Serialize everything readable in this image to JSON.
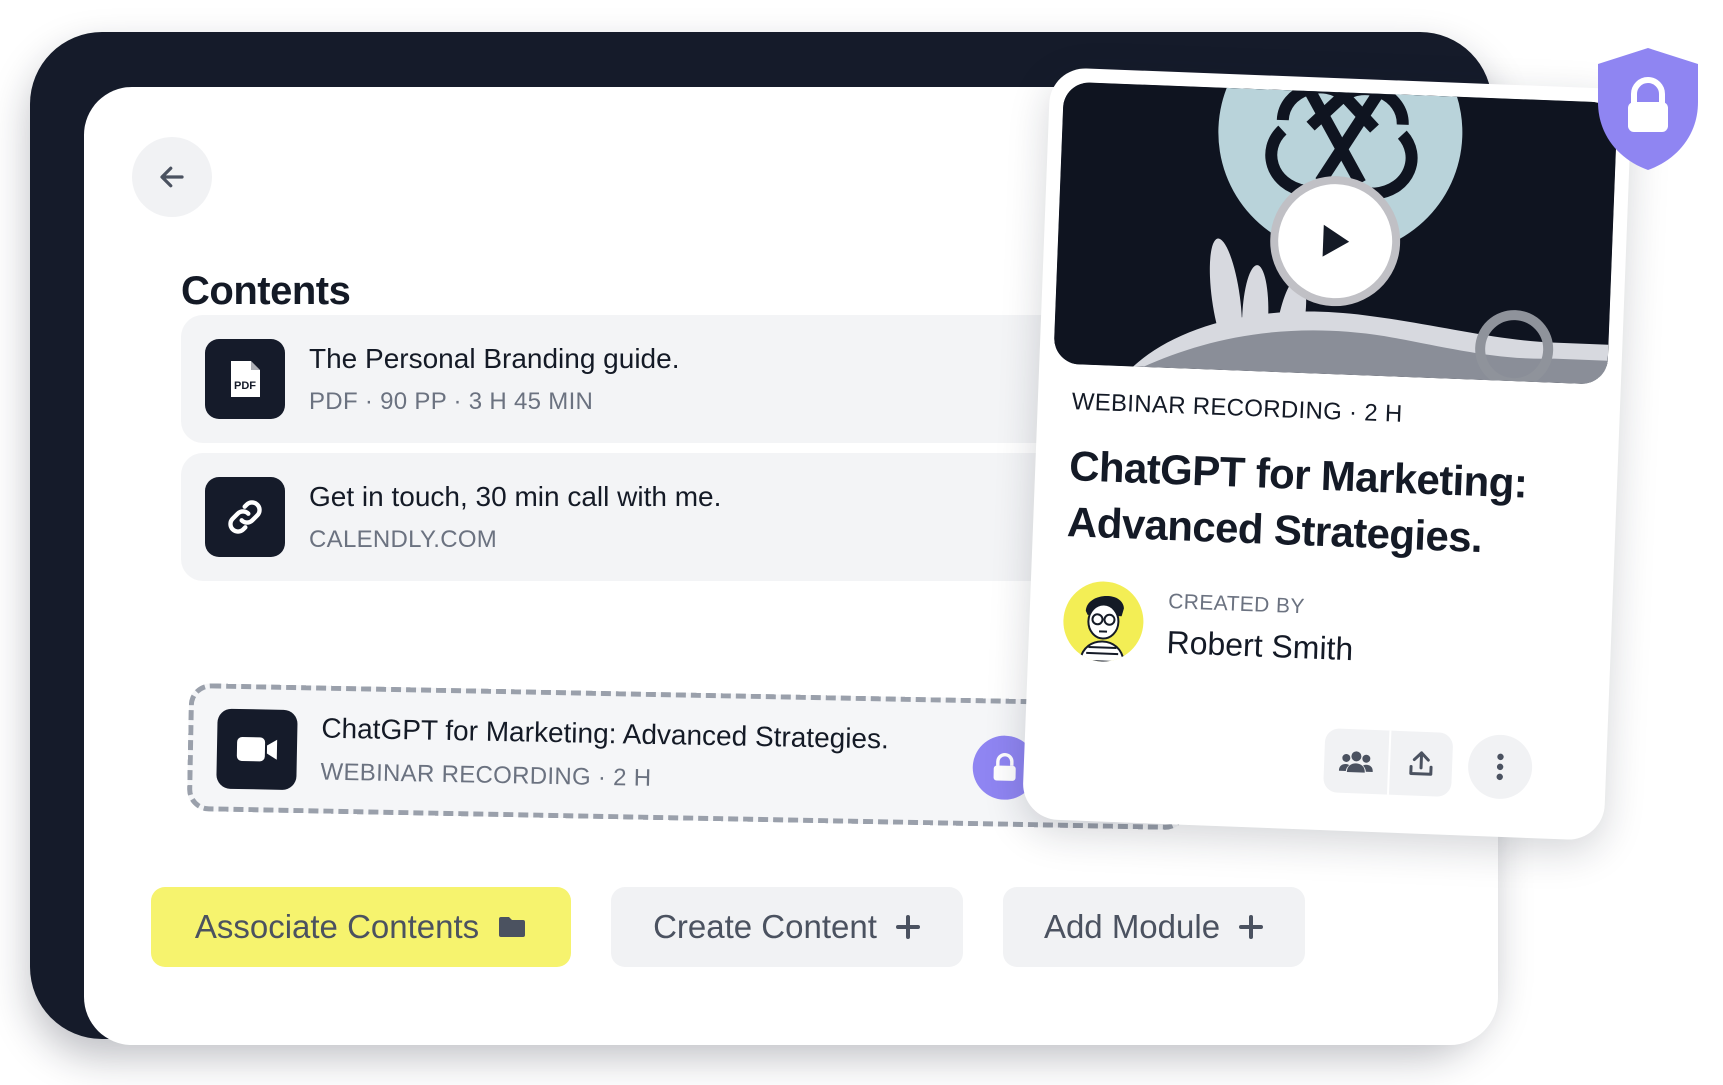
{
  "page": {
    "title": "Contents"
  },
  "contents": [
    {
      "title": "The Personal Branding guide.",
      "subtitle": "PDF · 90 PP · 3 H 45 MIN",
      "icon": "pdf-file-icon",
      "icon_text": "PDF"
    },
    {
      "title": "Get in touch, 30 min call with me.",
      "subtitle": "CALENDLY.COM",
      "icon": "link-icon"
    },
    {
      "title": "ChatGPT for Marketing: Advanced Strategies.",
      "subtitle": "WEBINAR RECORDING · 2 H",
      "icon": "video-camera-icon",
      "locked": true
    }
  ],
  "buttons": {
    "associate": "Associate Contents",
    "create": "Create Content",
    "add_module": "Add Module"
  },
  "card": {
    "meta": "WEBINAR RECORDING · 2 H",
    "title": "ChatGPT for Marketing: Advanced Strategies.",
    "created_by_label": "CREATED BY",
    "author": "Robert Smith"
  },
  "colors": {
    "frame": "#151b2a",
    "accent_yellow": "#f6f36e",
    "lock_purple": "#8f85f2",
    "row_bg": "#f3f4f6"
  }
}
